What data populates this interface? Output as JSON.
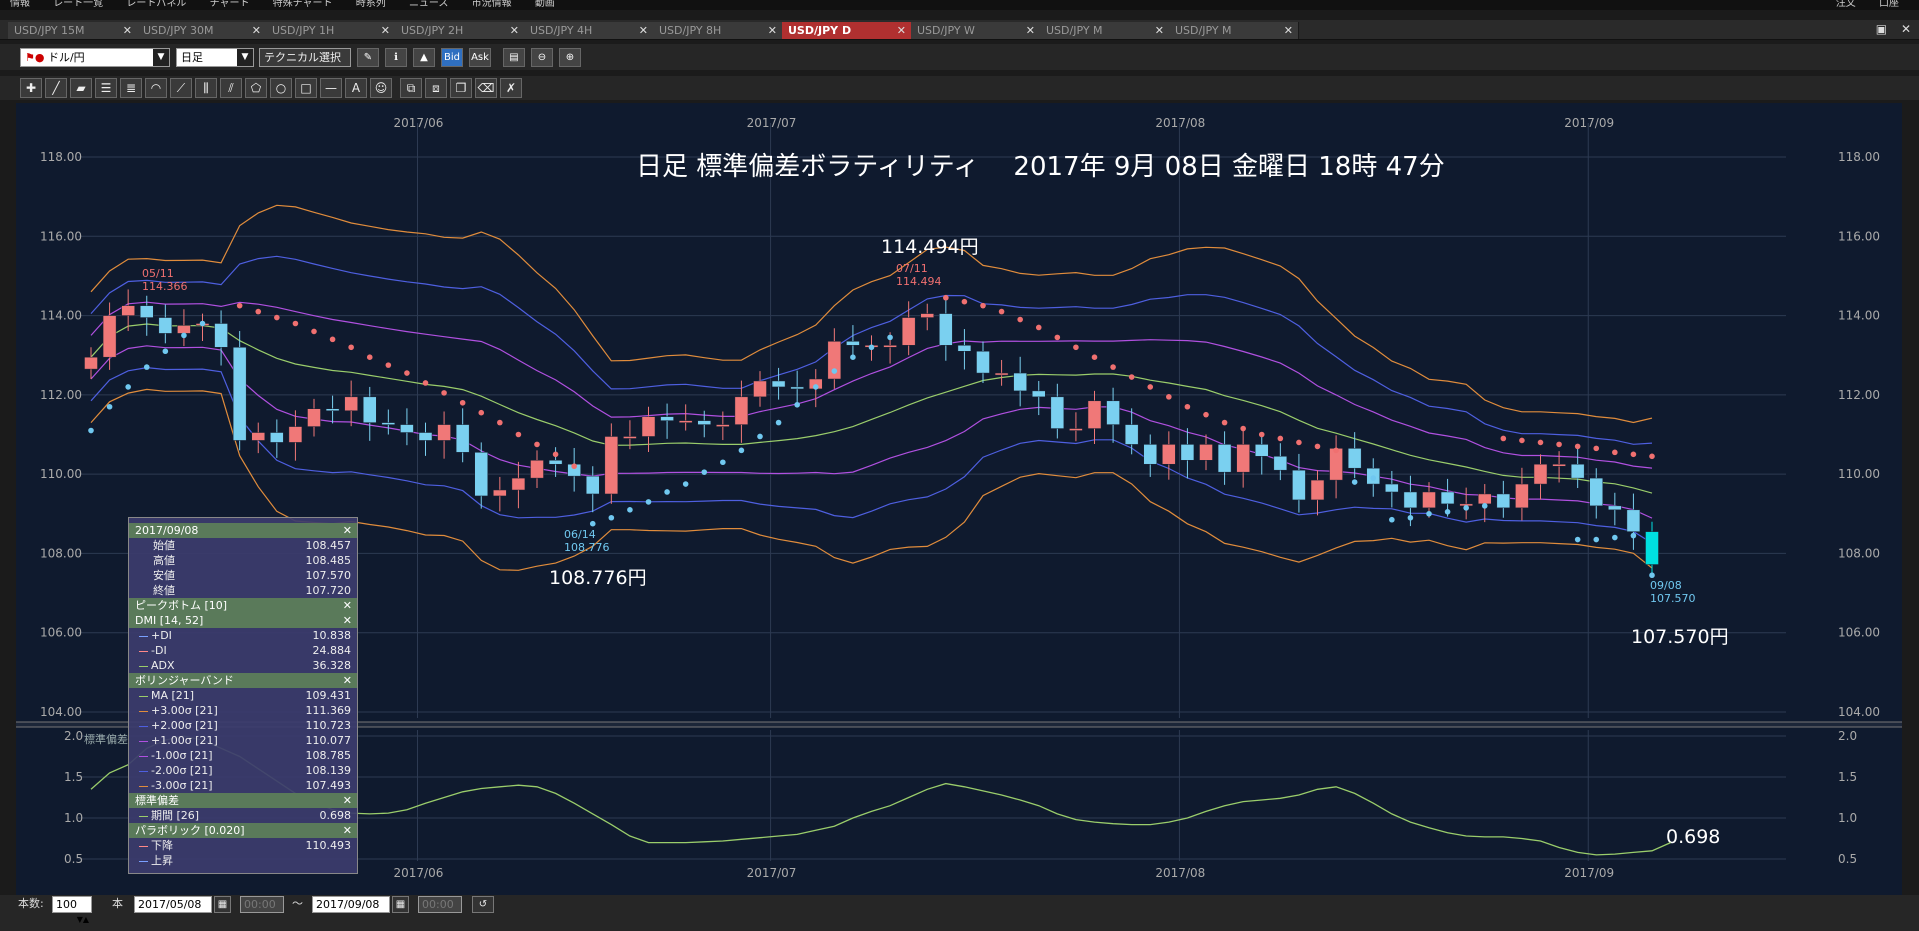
{
  "menu": {
    "items": [
      "情報",
      "レート一覧",
      "レートパネル",
      "チャート",
      "特殊チャート",
      "時系列",
      "ニュース",
      "市況情報",
      "動画"
    ],
    "right_items": [
      "注文",
      "口座"
    ]
  },
  "tabs": [
    {
      "label": "USD/JPY 15M",
      "active": false
    },
    {
      "label": "USD/JPY 30M",
      "active": false
    },
    {
      "label": "USD/JPY 1H",
      "active": false
    },
    {
      "label": "USD/JPY 2H",
      "active": false
    },
    {
      "label": "USD/JPY 4H",
      "active": false
    },
    {
      "label": "USD/JPY 8H",
      "active": false
    },
    {
      "label": "USD/JPY D",
      "active": true
    },
    {
      "label": "USD/JPY W",
      "active": false
    },
    {
      "label": "USD/JPY M",
      "active": false
    },
    {
      "label": "USD/JPY M",
      "active": false
    }
  ],
  "toolbar": {
    "pair": "ドル/円",
    "period": "日足",
    "technical": "テクニカル選択",
    "bid": "Bid",
    "ask": "Ask"
  },
  "chart_data": {
    "type": "candlestick",
    "title": "日足 標準偏差ボラティリティ　 2017年 9月 08日 金曜日 18時 47分",
    "price_axis": {
      "ylim": [
        104.0,
        118.0
      ],
      "ticks": [
        "118.00",
        "116.00",
        "114.00",
        "112.00",
        "110.00",
        "108.00",
        "106.00",
        "104.00"
      ]
    },
    "volatility_axis": {
      "ylim": [
        0.5,
        2.0
      ],
      "ticks": [
        "2.0",
        "1.5",
        "1.0",
        "0.5"
      ]
    },
    "x_ticks": [
      "2017/06",
      "2017/07",
      "2017/08",
      "2017/09"
    ],
    "colors": {
      "up": "#f07878",
      "down": "#7ad0f0",
      "last": "#00e0e0",
      "ma": "#9acd6b",
      "band1": "#b050e0",
      "band2": "#4e5fe0",
      "band3": "#e08c3c",
      "sar_red": "#f07070",
      "sar_blue": "#70c8f0",
      "vol": "#9acd6b"
    },
    "annotations": [
      {
        "date": "05/11",
        "price": "114.366"
      },
      {
        "date": "07/11",
        "price": "114.494"
      },
      {
        "date": "06/14",
        "price": "108.776"
      },
      {
        "date": "09/08",
        "price": "107.570"
      }
    ],
    "big_labels": [
      "114.494円",
      "108.776円",
      "107.570円",
      "0.698"
    ],
    "vol_label": "標準偏差",
    "closes": [
      112.95,
      114.0,
      114.25,
      113.95,
      113.55,
      113.75,
      113.8,
      113.2,
      110.85,
      111.05,
      110.8,
      111.2,
      111.65,
      111.6,
      111.95,
      111.3,
      111.25,
      111.05,
      110.85,
      111.25,
      110.55,
      109.45,
      109.6,
      109.9,
      110.35,
      110.25,
      109.95,
      109.5,
      110.95,
      110.95,
      111.45,
      111.35,
      111.35,
      111.25,
      111.25,
      111.95,
      112.35,
      112.2,
      112.15,
      112.4,
      113.35,
      113.25,
      113.25,
      113.25,
      113.95,
      114.05,
      113.25,
      113.1,
      112.55,
      112.55,
      112.1,
      111.95,
      111.15,
      111.15,
      111.85,
      111.25,
      110.75,
      110.25,
      110.75,
      110.35,
      110.75,
      110.05,
      110.75,
      110.45,
      110.1,
      109.35,
      109.85,
      110.65,
      110.15,
      109.75,
      109.55,
      109.15,
      109.55,
      109.25,
      109.25,
      109.5,
      109.15,
      109.75,
      110.25,
      110.25,
      109.9,
      109.2,
      109.1,
      108.55,
      107.72
    ],
    "sar_red": [
      [
        8,
        114.25
      ],
      [
        9,
        114.1
      ],
      [
        10,
        113.95
      ],
      [
        11,
        113.8
      ],
      [
        12,
        113.6
      ],
      [
        13,
        113.4
      ],
      [
        14,
        113.2
      ],
      [
        15,
        112.95
      ],
      [
        16,
        112.75
      ],
      [
        17,
        112.55
      ],
      [
        18,
        112.3
      ],
      [
        19,
        112.05
      ],
      [
        20,
        111.8
      ],
      [
        21,
        111.55
      ],
      [
        22,
        111.3
      ],
      [
        23,
        111.0
      ],
      [
        24,
        110.75
      ],
      [
        25,
        110.5
      ],
      [
        26,
        110.2
      ],
      [
        46,
        114.45
      ],
      [
        47,
        114.35
      ],
      [
        48,
        114.25
      ],
      [
        49,
        114.1
      ],
      [
        50,
        113.9
      ],
      [
        51,
        113.7
      ],
      [
        52,
        113.45
      ],
      [
        53,
        113.2
      ],
      [
        54,
        112.95
      ],
      [
        55,
        112.7
      ],
      [
        56,
        112.45
      ],
      [
        57,
        112.2
      ],
      [
        58,
        111.95
      ],
      [
        59,
        111.7
      ],
      [
        60,
        111.5
      ],
      [
        61,
        111.3
      ],
      [
        62,
        111.15
      ],
      [
        63,
        111.0
      ],
      [
        64,
        110.9
      ],
      [
        65,
        110.8
      ],
      [
        66,
        110.7
      ],
      [
        67,
        110.6
      ],
      [
        76,
        110.9
      ],
      [
        77,
        110.85
      ],
      [
        78,
        110.8
      ],
      [
        79,
        110.75
      ],
      [
        80,
        110.7
      ],
      [
        81,
        110.65
      ],
      [
        82,
        110.55
      ],
      [
        83,
        110.5
      ],
      [
        84,
        110.45
      ]
    ],
    "sar_blue": [
      [
        0,
        111.1
      ],
      [
        1,
        111.7
      ],
      [
        2,
        112.2
      ],
      [
        3,
        112.7
      ],
      [
        4,
        113.1
      ],
      [
        5,
        113.5
      ],
      [
        6,
        113.8
      ],
      [
        27,
        108.75
      ],
      [
        28,
        108.9
      ],
      [
        29,
        109.1
      ],
      [
        30,
        109.3
      ],
      [
        31,
        109.55
      ],
      [
        32,
        109.75
      ],
      [
        33,
        110.05
      ],
      [
        34,
        110.3
      ],
      [
        35,
        110.6
      ],
      [
        36,
        110.95
      ],
      [
        37,
        111.3
      ],
      [
        38,
        111.75
      ],
      [
        39,
        112.2
      ],
      [
        40,
        112.6
      ],
      [
        41,
        112.95
      ],
      [
        42,
        113.2
      ],
      [
        43,
        113.45
      ],
      [
        68,
        109.8
      ],
      [
        69,
        109.9
      ],
      [
        70,
        108.85
      ],
      [
        71,
        108.9
      ],
      [
        72,
        109.0
      ],
      [
        73,
        109.05
      ],
      [
        74,
        109.15
      ],
      [
        75,
        109.2
      ],
      [
        80,
        108.35
      ],
      [
        81,
        108.35
      ],
      [
        82,
        108.4
      ],
      [
        83,
        108.45
      ],
      [
        84,
        107.45
      ]
    ],
    "vol_series": [
      1.35,
      1.55,
      1.65,
      1.85,
      1.95,
      2.0,
      1.95,
      1.85,
      1.75,
      1.6,
      1.45,
      1.3,
      1.2,
      1.1,
      1.06,
      1.05,
      1.06,
      1.1,
      1.18,
      1.25,
      1.32,
      1.36,
      1.38,
      1.4,
      1.38,
      1.3,
      1.18,
      1.05,
      0.92,
      0.78,
      0.7,
      0.7,
      0.7,
      0.71,
      0.72,
      0.74,
      0.76,
      0.78,
      0.8,
      0.85,
      0.9,
      1.0,
      1.08,
      1.15,
      1.25,
      1.35,
      1.42,
      1.38,
      1.33,
      1.28,
      1.22,
      1.15,
      1.05,
      0.98,
      0.95,
      0.93,
      0.92,
      0.92,
      0.95,
      1.0,
      1.08,
      1.15,
      1.2,
      1.22,
      1.24,
      1.28,
      1.35,
      1.38,
      1.3,
      1.18,
      1.05,
      0.95,
      0.88,
      0.82,
      0.78,
      0.77,
      0.77,
      0.75,
      0.72,
      0.64,
      0.58,
      0.55,
      0.56,
      0.58,
      0.6,
      0.7
    ]
  },
  "info_panel": {
    "rows": [
      {
        "type": "head",
        "label": "2017/09/08"
      },
      {
        "type": "kv",
        "label": "始値",
        "value": "108.457"
      },
      {
        "type": "kv",
        "label": "高値",
        "value": "108.485"
      },
      {
        "type": "kv",
        "label": "安値",
        "value": "107.570"
      },
      {
        "type": "kv",
        "label": "終値",
        "value": "107.720"
      },
      {
        "type": "head",
        "label": "ピークボトム [10]"
      },
      {
        "type": "head",
        "label": "DMI [14, 52]"
      },
      {
        "type": "ind",
        "label": "+DI",
        "value": "10.838",
        "color": "#7aa0ff"
      },
      {
        "type": "ind",
        "label": "-DI",
        "value": "24.884",
        "color": "#ff8888"
      },
      {
        "type": "ind",
        "label": "ADX",
        "value": "36.328",
        "color": "#9acd6b"
      },
      {
        "type": "head",
        "label": "ボリンジャーバンド"
      },
      {
        "type": "ind",
        "label": "MA [21]",
        "value": "109.431",
        "color": "#9acd6b"
      },
      {
        "type": "ind",
        "label": "+3.00σ [21]",
        "value": "111.369",
        "color": "#e08c3c"
      },
      {
        "type": "ind",
        "label": "+2.00σ [21]",
        "value": "110.723",
        "color": "#4e5fe0"
      },
      {
        "type": "ind",
        "label": "+1.00σ [21]",
        "value": "110.077",
        "color": "#b050e0"
      },
      {
        "type": "ind",
        "label": "-1.00σ [21]",
        "value": "108.785",
        "color": "#b050e0"
      },
      {
        "type": "ind",
        "label": "-2.00σ [21]",
        "value": "108.139",
        "color": "#4e5fe0"
      },
      {
        "type": "ind",
        "label": "-3.00σ [21]",
        "value": "107.493",
        "color": "#e08c3c"
      },
      {
        "type": "head",
        "label": "標準偏差"
      },
      {
        "type": "ind",
        "label": "期間 [26]",
        "value": "0.698",
        "color": "#9acd6b"
      },
      {
        "type": "head",
        "label": "パラボリック [0.020]"
      },
      {
        "type": "ind",
        "label": "下降",
        "value": "110.493",
        "color": "#ff8888"
      },
      {
        "type": "ind",
        "label": "上昇",
        "value": "",
        "color": "#7aa0ff"
      }
    ]
  },
  "bottombar": {
    "count_label": "本数:",
    "count_value": "100",
    "count_unit": "本",
    "start_date": "2017/05/08",
    "start_time": "00:00",
    "tilde": "〜",
    "end_date": "2017/09/08",
    "end_time": "00:00"
  }
}
